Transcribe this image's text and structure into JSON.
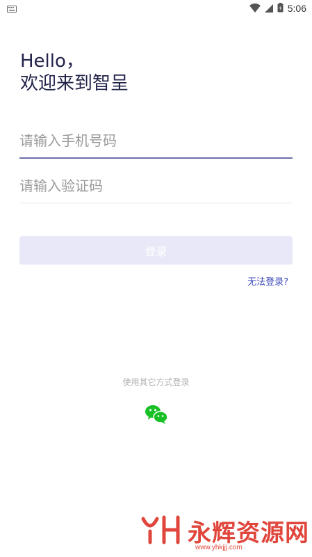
{
  "status_bar": {
    "time": "5:06",
    "icons": [
      "keyboard-icon",
      "wifi-icon",
      "cellular-signal-icon",
      "battery-icon"
    ]
  },
  "greeting": {
    "line1": "Hello，",
    "line2": "欢迎来到智呈"
  },
  "phone_input": {
    "placeholder": "请输入手机号码",
    "value": ""
  },
  "code_input": {
    "placeholder": "请输入验证码",
    "value": ""
  },
  "login_button": {
    "label": "登录"
  },
  "cannot_login_link": {
    "label": "无法登录?"
  },
  "other_login": {
    "label": "使用其它方式登录",
    "icon": "wechat-icon"
  },
  "watermark": {
    "text": "永辉资源网",
    "url": "www.yhkjjj.com"
  },
  "colors": {
    "title": "#23244a",
    "accent": "#3a47b8",
    "button_disabled": "#e8e8f8",
    "wechat_green": "#19c025",
    "watermark": "#e0463c"
  }
}
